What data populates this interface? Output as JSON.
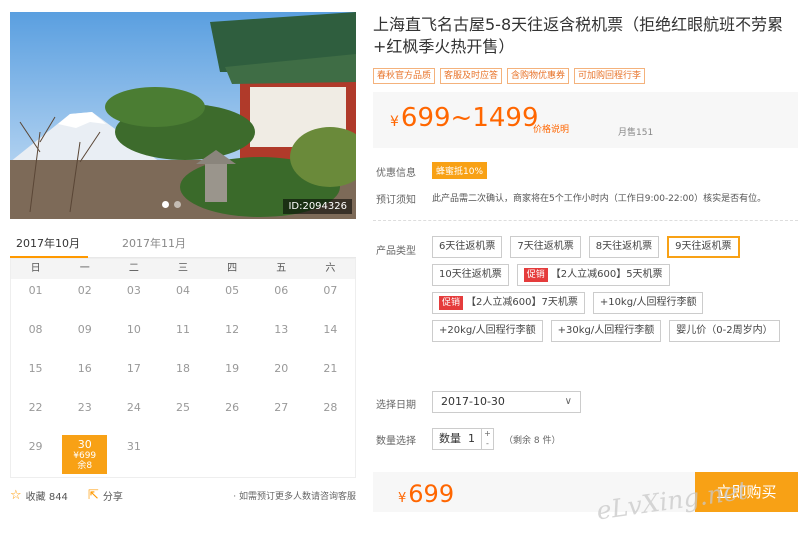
{
  "hero": {
    "image_id": "ID:2094326"
  },
  "calendar": {
    "tabs": [
      "2017年10月",
      "2017年11月"
    ],
    "weekdays": [
      "日",
      "一",
      "二",
      "三",
      "四",
      "五",
      "六"
    ],
    "days": [
      "01",
      "02",
      "03",
      "04",
      "05",
      "06",
      "07",
      "08",
      "09",
      "10",
      "11",
      "12",
      "13",
      "14",
      "15",
      "16",
      "17",
      "18",
      "19",
      "20",
      "21",
      "22",
      "23",
      "24",
      "25",
      "26",
      "27",
      "28",
      "29",
      "30",
      "31"
    ],
    "selected_day": {
      "day": "30",
      "price": "¥699",
      "remain": "余8"
    }
  },
  "bottom": {
    "favorite": "收藏 844",
    "share": "分享",
    "note": "· 如需预订更多人数请咨询客服"
  },
  "product": {
    "title": "上海直飞名古屋5-8天往返含税机票（拒绝红眼航班不劳累+红枫季火热开售）",
    "tags": [
      "春秋官方品质",
      "客服及时应答",
      "含购物优惠券",
      "可加购回程行李"
    ],
    "price": "699~1499",
    "currency": "¥",
    "price_note": "价格说明",
    "monthly": "月售151",
    "discount_label": "优惠信息",
    "discount_badge": "蜂蜜抵10%",
    "notice_label": "预订须知",
    "notice": "此产品需二次确认，商家将在5个工作小时内（工作日9:00-22:00）核实是否有位。",
    "type_label": "产品类型",
    "options": [
      {
        "label": "6天往返机票",
        "promo": ""
      },
      {
        "label": "7天往返机票",
        "promo": ""
      },
      {
        "label": "8天往返机票",
        "promo": ""
      },
      {
        "label": "9天往返机票",
        "promo": "",
        "selected": true
      },
      {
        "label": "10天往返机票",
        "promo": ""
      },
      {
        "label": "【2人立减600】5天机票",
        "promo": "促销"
      },
      {
        "label": "【2人立减600】7天机票",
        "promo": "促销"
      },
      {
        "label": "+10kg/人回程行李额",
        "promo": ""
      },
      {
        "label": "+20kg/人回程行李额",
        "promo": ""
      },
      {
        "label": "+30kg/人回程行李额",
        "promo": ""
      },
      {
        "label": "婴儿价（0-2周岁内）",
        "promo": ""
      }
    ],
    "date_label": "选择日期",
    "date_value": "2017-10-30",
    "qty_label": "数量选择",
    "qty_prefix": "数量",
    "qty_value": "1",
    "qty_remain": "（剩余 8 件）",
    "buy_price": "699",
    "buy_button": "立即购买"
  },
  "watermark": "eLvXing.net"
}
